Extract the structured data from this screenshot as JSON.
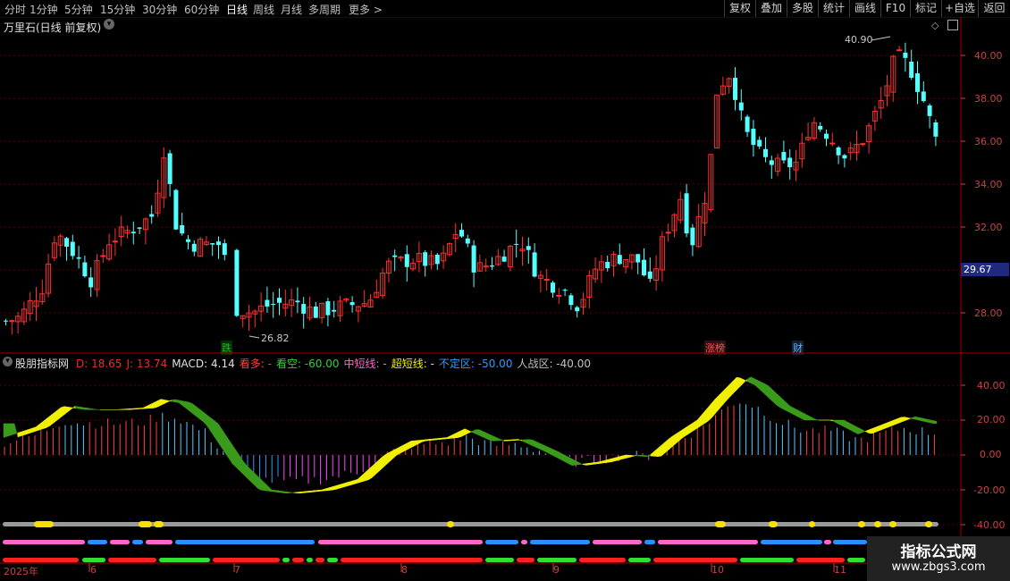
{
  "toolbar": {
    "periods": [
      "分时",
      "1分钟",
      "5分钟",
      "15分钟",
      "30分钟",
      "60分钟",
      "日线",
      "周线",
      "月线",
      "多周期",
      "更多 >"
    ],
    "active_period": "日线",
    "right_buttons": [
      "复权",
      "叠加",
      "多股",
      "统计",
      "画线",
      "F10",
      "标记",
      "+自选",
      "返回"
    ]
  },
  "price_panel": {
    "title": "万里石(日线 前复权)",
    "high_annotation": "40.90",
    "low_annotation": "26.82",
    "current_price": "29.67",
    "y_ticks": [
      "40.00",
      "38.00",
      "36.00",
      "34.00",
      "32.00",
      "28.00"
    ],
    "event_tags": [
      {
        "text": "跌",
        "color": "#00d000"
      },
      {
        "text": "涨榜",
        "color": "#ff5050"
      },
      {
        "text": "财",
        "color": "#60b0ff"
      }
    ]
  },
  "indicator_panel": {
    "name": "股朋指标网",
    "items": [
      {
        "label": "D: ",
        "value": "18.65",
        "color": "#e03030"
      },
      {
        "label": "J: ",
        "value": "13.74",
        "color": "#e03030"
      },
      {
        "label": "MACD: ",
        "value": "4.14",
        "color": "#e0e0e0"
      },
      {
        "label": "看多: ",
        "value": "-",
        "color": "#ff4040"
      },
      {
        "label": "看空: ",
        "value": "-60.00",
        "color": "#30d030"
      },
      {
        "label": "中短线: ",
        "value": "-",
        "color": "#ff66cc"
      },
      {
        "label": "超短线: ",
        "value": "-",
        "color": "#f0f000"
      },
      {
        "label": "不定区: ",
        "value": "-50.00",
        "color": "#3399ff"
      },
      {
        "label": "人战区: ",
        "value": "-40.00",
        "color": "#c0c0c0"
      }
    ],
    "y_ticks": [
      "40.00",
      "20.00",
      "0.00",
      "-20.00",
      "-40.00"
    ]
  },
  "x_axis": {
    "labels": [
      "2025年",
      "6",
      "7",
      "8",
      "9",
      "10",
      "11"
    ]
  },
  "watermark": {
    "line1": "指标公式网",
    "line2": "www.zbgs3.com"
  },
  "colors": {
    "up": "#ff3030",
    "down": "#54ffff",
    "grid": "#5a0000",
    "axis": "#d04040"
  }
}
